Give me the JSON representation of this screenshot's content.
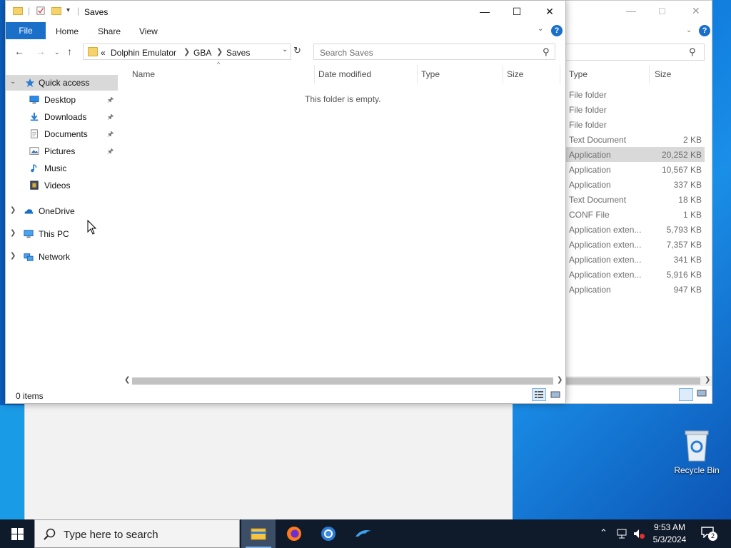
{
  "window": {
    "title": "Saves",
    "ribbon_tabs": [
      "File",
      "Home",
      "Share",
      "View"
    ],
    "help_label": "?",
    "breadcrumb": {
      "overflow": "«",
      "items": [
        "Dolphin Emulator",
        "GBA",
        "Saves"
      ]
    },
    "search_placeholder": "Search Saves",
    "columns": [
      "Name",
      "Date modified",
      "Type",
      "Size"
    ],
    "empty_message": "This folder is empty.",
    "status": "0 items",
    "accent_color": "#1a6fc9"
  },
  "nav_pane": {
    "quick_access": "Quick access",
    "quick_items": [
      {
        "label": "Desktop",
        "icon": "desktop-icon",
        "pinned": true
      },
      {
        "label": "Downloads",
        "icon": "downloads-icon",
        "pinned": true
      },
      {
        "label": "Documents",
        "icon": "documents-icon",
        "pinned": true
      },
      {
        "label": "Pictures",
        "icon": "pictures-icon",
        "pinned": true
      },
      {
        "label": "Music",
        "icon": "music-icon",
        "pinned": false
      },
      {
        "label": "Videos",
        "icon": "videos-icon",
        "pinned": false
      }
    ],
    "roots": [
      {
        "label": "OneDrive",
        "icon": "onedrive-icon"
      },
      {
        "label": "This PC",
        "icon": "this-pc-icon"
      },
      {
        "label": "Network",
        "icon": "network-icon"
      }
    ]
  },
  "background_window": {
    "help_label": "?",
    "columns": [
      "Type",
      "Size"
    ],
    "rows": [
      {
        "type": "File folder",
        "size": ""
      },
      {
        "type": "File folder",
        "size": ""
      },
      {
        "type": "File folder",
        "size": ""
      },
      {
        "type": "Text Document",
        "size": "2 KB"
      },
      {
        "type": "Application",
        "size": "20,252 KB",
        "selected": true
      },
      {
        "type": "Application",
        "size": "10,567 KB"
      },
      {
        "type": "Application",
        "size": "337 KB"
      },
      {
        "type": "Text Document",
        "size": "18 KB"
      },
      {
        "type": "CONF File",
        "size": "1 KB"
      },
      {
        "type": "Application exten...",
        "size": "5,793 KB"
      },
      {
        "type": "Application exten...",
        "size": "7,357 KB"
      },
      {
        "type": "Application exten...",
        "size": "341 KB"
      },
      {
        "type": "Application exten...",
        "size": "5,916 KB"
      },
      {
        "type": "Application",
        "size": "947 KB"
      }
    ]
  },
  "desktop": {
    "recycle_bin": "Recycle Bin"
  },
  "taskbar": {
    "search_placeholder": "Type here to search",
    "apps": [
      "file-explorer-icon",
      "firefox-icon",
      "chrome-icon",
      "dolphin-icon"
    ],
    "time": "9:53 AM",
    "date": "5/3/2024",
    "notification_count": "2"
  }
}
